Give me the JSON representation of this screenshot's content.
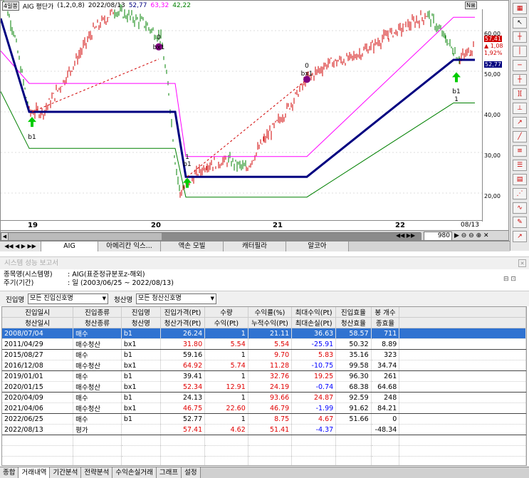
{
  "chart": {
    "header": {
      "symbol": "AIG 평단가",
      "params": "(1,2,0,8)",
      "date": "2022/08/13",
      "v1": "52,77",
      "v2": "63,32",
      "v3": "42,22",
      "btn_left": "4일봉",
      "btn_right": "N⊞"
    },
    "y_ticks": [
      "60,00",
      "50,00",
      "40,00",
      "30,00",
      "20,00"
    ],
    "price_tags": {
      "last": "57,41",
      "change": "▲ 1,08",
      "pct": "1,92%",
      "blue": "52,77"
    },
    "x_ticks": [
      "19",
      "20",
      "21",
      "22"
    ],
    "date_label": "08/13",
    "zoom_value": "980",
    "signal_labels": [
      {
        "top": "0",
        "bottom": "bx1"
      },
      {
        "top": "0",
        "bottom": "bx1"
      },
      {
        "top": "",
        "bottom": "b1"
      },
      {
        "top": "b1",
        "bottom": "1"
      },
      {
        "top": "1",
        "bottom": "b1"
      }
    ],
    "colors": {
      "price_up": "#d00000",
      "price_down": "#008000",
      "mid_line": "#000080",
      "upper": "#ff00ff",
      "lower": "#008000",
      "buy_arrow": "#00cc00",
      "exit_dot": "#800080"
    }
  },
  "chart_tabs": [
    "AIG",
    "아메리칸 익스...",
    "액손 모빌",
    "캐터필라",
    "알코아"
  ],
  "report": {
    "title": "시스템 성능 보고서",
    "item_label": "종목명(시스템명)",
    "item_value": ": AIG(표준정규분포z-해외)",
    "period_label": "주기(기간)",
    "period_value": ": 일 (2003/06/25 ~ 2022/08/13)",
    "entry_label": "진입명",
    "entry_value": "모든 진입신호명",
    "exit_label": "청산명",
    "exit_value": "모든 청산신호명"
  },
  "table": {
    "headers_top": [
      "진입일시",
      "진입종류",
      "진입명",
      "진입가격(Pt)",
      "수량",
      "수익률(%)",
      "최대수익(Pt)",
      "진입효율",
      "봉 개수"
    ],
    "headers_bottom": [
      "청산일시",
      "청산종류",
      "청산명",
      "청산가격(Pt)",
      "수익(Pt)",
      "누적수익(Pt)",
      "최대손실(Pt)",
      "청산효율",
      "종효율"
    ],
    "rows": [
      [
        "2008/07/04",
        "매수",
        "b1",
        "26.24",
        "1",
        "21.11",
        "36.63",
        "58.57",
        "711"
      ],
      [
        "2011/04/29",
        "매수청산",
        "bx1",
        "31.80",
        "5.54",
        "5.54",
        "-25.91",
        "50.32",
        "8.89"
      ],
      [
        "2015/08/27",
        "매수",
        "b1",
        "59.16",
        "1",
        "9.70",
        "5.83",
        "35.16",
        "323"
      ],
      [
        "2016/12/08",
        "매수청산",
        "bx1",
        "64.92",
        "5.74",
        "11.28",
        "-10.75",
        "99.58",
        "34.74"
      ],
      [
        "2019/01/01",
        "매수",
        "b1",
        "39.41",
        "1",
        "32.76",
        "19.25",
        "96.30",
        "261"
      ],
      [
        "2020/01/15",
        "매수청산",
        "bx1",
        "52.34",
        "12.91",
        "24.19",
        "-0.74",
        "68.38",
        "64.68"
      ],
      [
        "2020/04/09",
        "매수",
        "b1",
        "24.13",
        "1",
        "93.66",
        "24.87",
        "92.59",
        "248"
      ],
      [
        "2021/04/06",
        "매수청산",
        "bx1",
        "46.75",
        "22.60",
        "46.79",
        "-1.99",
        "91.62",
        "84.21"
      ],
      [
        "2022/06/25",
        "매수",
        "b1",
        "52.77",
        "1",
        "8.75",
        "4.67",
        "51.66",
        "0"
      ],
      [
        "2022/08/13",
        "평가",
        "",
        "57.41",
        "4.62",
        "51.41",
        "-4.37",
        "",
        "-48.34"
      ]
    ]
  },
  "bottom_tabs": [
    "종합",
    "거래내역",
    "기간분석",
    "전략분석",
    "수익손실거래",
    "그래프",
    "설정"
  ]
}
